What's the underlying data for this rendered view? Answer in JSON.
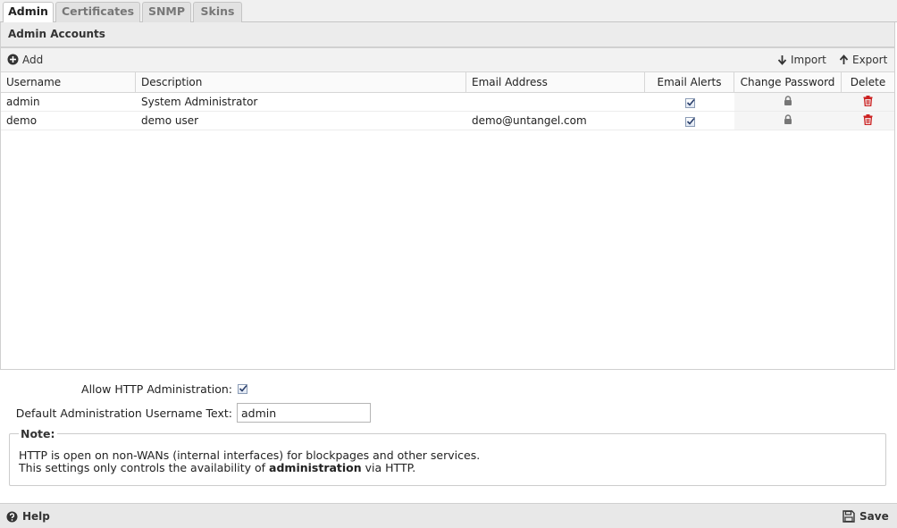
{
  "tabs": [
    {
      "label": "Admin",
      "active": true
    },
    {
      "label": "Certificates",
      "active": false
    },
    {
      "label": "SNMP",
      "active": false
    },
    {
      "label": "Skins",
      "active": false
    }
  ],
  "section": {
    "title": "Admin Accounts"
  },
  "toolbar": {
    "add_label": "Add",
    "import_label": "Import",
    "export_label": "Export"
  },
  "grid": {
    "columns": [
      "Username",
      "Description",
      "Email Address",
      "Email Alerts",
      "Change Password",
      "Delete"
    ],
    "rows": [
      {
        "username": "admin",
        "description": "System Administrator",
        "email": "",
        "email_alerts": true
      },
      {
        "username": "demo",
        "description": "demo user",
        "email": "demo@untangel.com",
        "email_alerts": true
      }
    ]
  },
  "form": {
    "allow_http_label": "Allow HTTP Administration:",
    "allow_http_checked": true,
    "default_username_label": "Default Administration Username Text:",
    "default_username_value": "admin"
  },
  "note": {
    "legend": "Note:",
    "line1": "HTTP is open on non-WANs (internal interfaces) for blockpages and other services.",
    "line2_prefix": "This settings only controls the availability of ",
    "line2_bold": "administration",
    "line2_suffix": " via HTTP."
  },
  "footer": {
    "help_label": "Help",
    "save_label": "Save"
  },
  "colors": {
    "delete_icon": "#cc2222",
    "lock_icon": "#777777",
    "checkbox_border": "#8a9bb5"
  }
}
